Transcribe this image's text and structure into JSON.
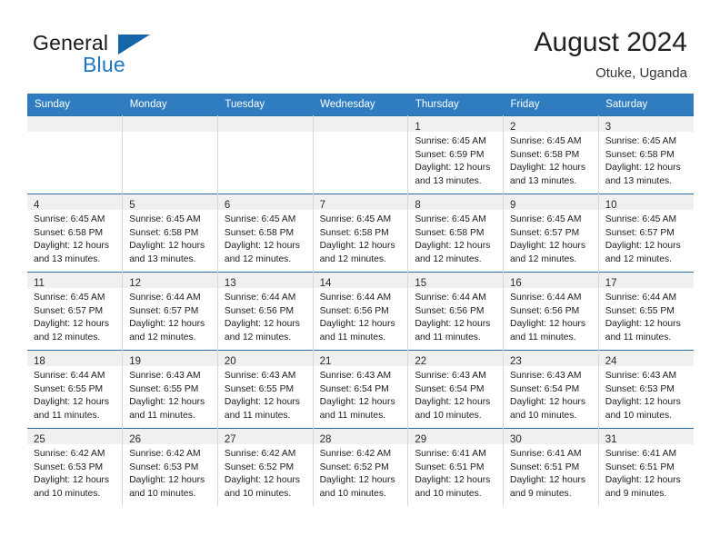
{
  "brand": {
    "name_part1": "General",
    "name_part2": "Blue",
    "logo_icon": "triangle-flag-icon",
    "accent_color": "#1e76c4"
  },
  "header": {
    "title": "August 2024",
    "subtitle": "Otuke, Uganda"
  },
  "calendar": {
    "header_bg": "#2f7cc0",
    "daynum_bg": "#f0f0f0",
    "row_border": "#2c6ea8",
    "weekday_headers": [
      "Sunday",
      "Monday",
      "Tuesday",
      "Wednesday",
      "Thursday",
      "Friday",
      "Saturday"
    ],
    "weeks": [
      [
        {
          "day": "",
          "lines": []
        },
        {
          "day": "",
          "lines": []
        },
        {
          "day": "",
          "lines": []
        },
        {
          "day": "",
          "lines": []
        },
        {
          "day": "1",
          "lines": [
            "Sunrise: 6:45 AM",
            "Sunset: 6:59 PM",
            "Daylight: 12 hours",
            "and 13 minutes."
          ]
        },
        {
          "day": "2",
          "lines": [
            "Sunrise: 6:45 AM",
            "Sunset: 6:58 PM",
            "Daylight: 12 hours",
            "and 13 minutes."
          ]
        },
        {
          "day": "3",
          "lines": [
            "Sunrise: 6:45 AM",
            "Sunset: 6:58 PM",
            "Daylight: 12 hours",
            "and 13 minutes."
          ]
        }
      ],
      [
        {
          "day": "4",
          "lines": [
            "Sunrise: 6:45 AM",
            "Sunset: 6:58 PM",
            "Daylight: 12 hours",
            "and 13 minutes."
          ]
        },
        {
          "day": "5",
          "lines": [
            "Sunrise: 6:45 AM",
            "Sunset: 6:58 PM",
            "Daylight: 12 hours",
            "and 13 minutes."
          ]
        },
        {
          "day": "6",
          "lines": [
            "Sunrise: 6:45 AM",
            "Sunset: 6:58 PM",
            "Daylight: 12 hours",
            "and 12 minutes."
          ]
        },
        {
          "day": "7",
          "lines": [
            "Sunrise: 6:45 AM",
            "Sunset: 6:58 PM",
            "Daylight: 12 hours",
            "and 12 minutes."
          ]
        },
        {
          "day": "8",
          "lines": [
            "Sunrise: 6:45 AM",
            "Sunset: 6:58 PM",
            "Daylight: 12 hours",
            "and 12 minutes."
          ]
        },
        {
          "day": "9",
          "lines": [
            "Sunrise: 6:45 AM",
            "Sunset: 6:57 PM",
            "Daylight: 12 hours",
            "and 12 minutes."
          ]
        },
        {
          "day": "10",
          "lines": [
            "Sunrise: 6:45 AM",
            "Sunset: 6:57 PM",
            "Daylight: 12 hours",
            "and 12 minutes."
          ]
        }
      ],
      [
        {
          "day": "11",
          "lines": [
            "Sunrise: 6:45 AM",
            "Sunset: 6:57 PM",
            "Daylight: 12 hours",
            "and 12 minutes."
          ]
        },
        {
          "day": "12",
          "lines": [
            "Sunrise: 6:44 AM",
            "Sunset: 6:57 PM",
            "Daylight: 12 hours",
            "and 12 minutes."
          ]
        },
        {
          "day": "13",
          "lines": [
            "Sunrise: 6:44 AM",
            "Sunset: 6:56 PM",
            "Daylight: 12 hours",
            "and 12 minutes."
          ]
        },
        {
          "day": "14",
          "lines": [
            "Sunrise: 6:44 AM",
            "Sunset: 6:56 PM",
            "Daylight: 12 hours",
            "and 11 minutes."
          ]
        },
        {
          "day": "15",
          "lines": [
            "Sunrise: 6:44 AM",
            "Sunset: 6:56 PM",
            "Daylight: 12 hours",
            "and 11 minutes."
          ]
        },
        {
          "day": "16",
          "lines": [
            "Sunrise: 6:44 AM",
            "Sunset: 6:56 PM",
            "Daylight: 12 hours",
            "and 11 minutes."
          ]
        },
        {
          "day": "17",
          "lines": [
            "Sunrise: 6:44 AM",
            "Sunset: 6:55 PM",
            "Daylight: 12 hours",
            "and 11 minutes."
          ]
        }
      ],
      [
        {
          "day": "18",
          "lines": [
            "Sunrise: 6:44 AM",
            "Sunset: 6:55 PM",
            "Daylight: 12 hours",
            "and 11 minutes."
          ]
        },
        {
          "day": "19",
          "lines": [
            "Sunrise: 6:43 AM",
            "Sunset: 6:55 PM",
            "Daylight: 12 hours",
            "and 11 minutes."
          ]
        },
        {
          "day": "20",
          "lines": [
            "Sunrise: 6:43 AM",
            "Sunset: 6:55 PM",
            "Daylight: 12 hours",
            "and 11 minutes."
          ]
        },
        {
          "day": "21",
          "lines": [
            "Sunrise: 6:43 AM",
            "Sunset: 6:54 PM",
            "Daylight: 12 hours",
            "and 11 minutes."
          ]
        },
        {
          "day": "22",
          "lines": [
            "Sunrise: 6:43 AM",
            "Sunset: 6:54 PM",
            "Daylight: 12 hours",
            "and 10 minutes."
          ]
        },
        {
          "day": "23",
          "lines": [
            "Sunrise: 6:43 AM",
            "Sunset: 6:54 PM",
            "Daylight: 12 hours",
            "and 10 minutes."
          ]
        },
        {
          "day": "24",
          "lines": [
            "Sunrise: 6:43 AM",
            "Sunset: 6:53 PM",
            "Daylight: 12 hours",
            "and 10 minutes."
          ]
        }
      ],
      [
        {
          "day": "25",
          "lines": [
            "Sunrise: 6:42 AM",
            "Sunset: 6:53 PM",
            "Daylight: 12 hours",
            "and 10 minutes."
          ]
        },
        {
          "day": "26",
          "lines": [
            "Sunrise: 6:42 AM",
            "Sunset: 6:53 PM",
            "Daylight: 12 hours",
            "and 10 minutes."
          ]
        },
        {
          "day": "27",
          "lines": [
            "Sunrise: 6:42 AM",
            "Sunset: 6:52 PM",
            "Daylight: 12 hours",
            "and 10 minutes."
          ]
        },
        {
          "day": "28",
          "lines": [
            "Sunrise: 6:42 AM",
            "Sunset: 6:52 PM",
            "Daylight: 12 hours",
            "and 10 minutes."
          ]
        },
        {
          "day": "29",
          "lines": [
            "Sunrise: 6:41 AM",
            "Sunset: 6:51 PM",
            "Daylight: 12 hours",
            "and 10 minutes."
          ]
        },
        {
          "day": "30",
          "lines": [
            "Sunrise: 6:41 AM",
            "Sunset: 6:51 PM",
            "Daylight: 12 hours",
            "and 9 minutes."
          ]
        },
        {
          "day": "31",
          "lines": [
            "Sunrise: 6:41 AM",
            "Sunset: 6:51 PM",
            "Daylight: 12 hours",
            "and 9 minutes."
          ]
        }
      ]
    ]
  }
}
